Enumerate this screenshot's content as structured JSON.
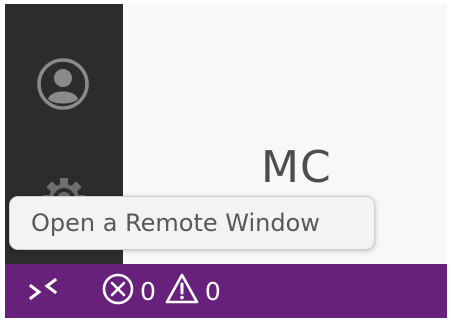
{
  "editor": {
    "heading_fragment": "MC"
  },
  "tooltip": {
    "text": "Open a Remote Window"
  },
  "status_bar": {
    "background": "#68217a",
    "remote_button": {
      "icon": "remote-window-icon"
    },
    "problems": {
      "errors_icon": "error-circle-icon",
      "errors": "0",
      "warnings_icon": "warning-triangle-icon",
      "warnings": "0"
    }
  },
  "activity_bar": {
    "background": "#2c2c2c",
    "items": [
      {
        "icon": "account-icon"
      },
      {
        "icon": "gear-icon"
      }
    ]
  }
}
